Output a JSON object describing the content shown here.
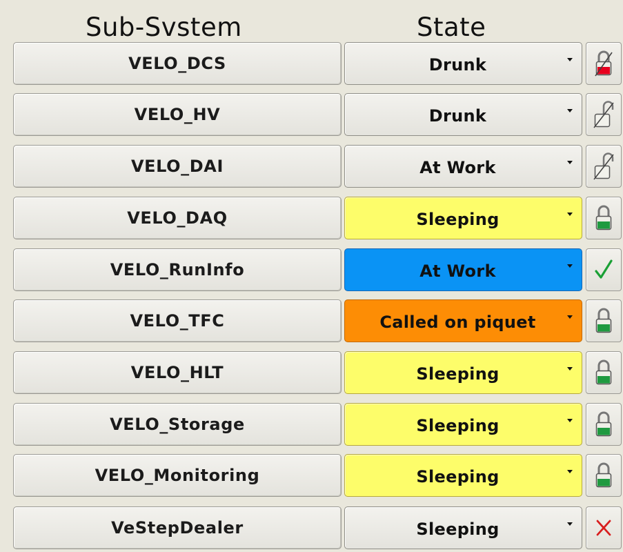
{
  "headers": {
    "subsystem": "Sub-Svstem",
    "state": "State"
  },
  "rows": [
    {
      "name": "VELO_DCS",
      "state": "Drunk",
      "state_color": "#e6e4df",
      "icon": "lock-red-icon"
    },
    {
      "name": "VELO_HV",
      "state": "Drunk",
      "state_color": "#e6e4df",
      "icon": "unlocked-icon"
    },
    {
      "name": "VELO_DAI",
      "state": "At Work",
      "state_color": "#e6e4df",
      "icon": "unlocked-icon"
    },
    {
      "name": "VELO_DAQ",
      "state": "Sleeping",
      "state_color": "#fdfd6a",
      "icon": "lock-green-icon"
    },
    {
      "name": "VELO_RunInfo",
      "state": "At Work",
      "state_color": "#0a93f5",
      "icon": "check-icon"
    },
    {
      "name": "VELO_TFC",
      "state": "Called on piquet",
      "state_color": "#fd8d05",
      "icon": "lock-green-icon"
    },
    {
      "name": "VELO_HLT",
      "state": "Sleeping",
      "state_color": "#fdfd6a",
      "icon": "lock-green-icon"
    },
    {
      "name": "VELO_Storage",
      "state": "Sleeping",
      "state_color": "#fdfd6a",
      "icon": "lock-green-icon"
    },
    {
      "name": "VELO_Monitoring",
      "state": "Sleeping",
      "state_color": "#fdfd6a",
      "icon": "lock-green-icon"
    },
    {
      "name": "VeStepDealer",
      "state": "Sleeping",
      "state_color": "#e6e4df",
      "icon": "cross-icon"
    }
  ]
}
